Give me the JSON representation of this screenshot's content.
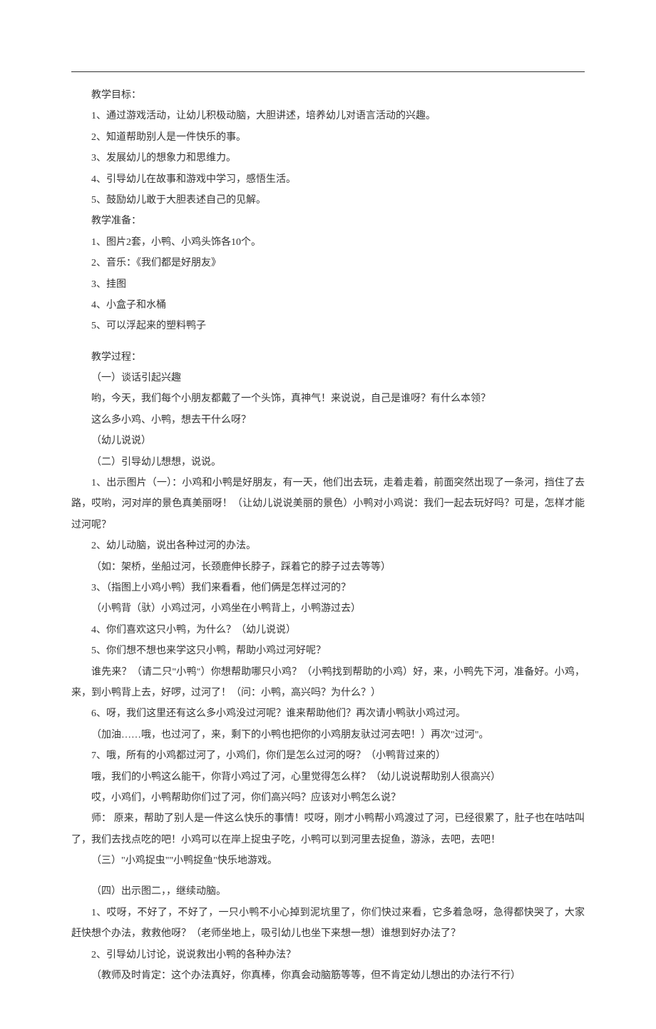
{
  "section_goals_title": "教学目标：",
  "goals": [
    "1、通过游戏活动，让幼儿积极动脑，大胆讲述，培养幼儿对语言活动的兴趣。",
    "2、知道帮助别人是一件快乐的事。",
    "3、发展幼儿的想象力和思维力。",
    "4、引导幼儿在故事和游戏中学习，感悟生活。",
    "5、鼓励幼儿敢于大胆表述自己的见解。"
  ],
  "section_prep_title": "教学准备：",
  "preps": [
    "1、图片2套，小鸭、小鸡头饰各10个。",
    "2、音乐：《我们都是好朋友》",
    "3、挂图",
    "4、小盒子和水桶",
    "5、可以浮起来的塑料鸭子"
  ],
  "section_process_title": "教学过程：",
  "part1_title": "（一）谈话引起兴趣",
  "part1_line1": "哟，今天，我们每个小朋友都戴了一个头饰，真神气！来说说，自己是谁呀？有什么本领？",
  "part1_line2": "这么多小鸡、小鸭，想去干什么呀？",
  "part1_line3": "（幼儿说说）",
  "part2_title": "（二）引导幼儿想想，说说。",
  "part2_item1": "1、出示图片（一）：小鸡和小鸭是好朋友，有一天，他们出去玩，走着走着，前面突然出现了一条河，挡住了去路，哎哟，河对岸的景色真美丽呀！（让幼儿说说美丽的景色）小鸭对小鸡说：我们一起去玩好吗？可是，怎样才能过河呢？",
  "part2_item2": "2、幼儿动脑，说出各种过河的办法。",
  "part2_item2_note": "（如：架桥，坐船过河，长颈鹿伸长脖子，踩着它的脖子过去等等）",
  "part2_item3": "3、（指图上小鸡小鸭）我们来看看，他们俩是怎样过河的？",
  "part2_item3_note": "（小鸭背（驮）小鸡过河，小鸡坐在小鸭背上，小鸭游过去）",
  "part2_item4": "4、你们喜欢这只小鸭，为什么？（幼儿说说）",
  "part2_item5": "5、你们想不想也来学这只小鸭，帮助小鸡过河好呢？",
  "part2_item5_note": "谁先来？（请二只\"小鸭\"）你想帮助哪只小鸡？（小鸭找到帮助的小鸡）好，来，小鸭先下河，准备好。小鸡，来，到小鸭背上去，好啰，过河了！（问：小鸭，高兴吗？为什么？）",
  "part2_item6": "6、呀，我们这里还有这么多小鸡没过河呢？谁来帮助他们？再次请小鸭驮小鸡过河。",
  "part2_item6_note": "（加油……哦，也过河了，来，剩下的小鸭也把你的小鸡朋友驮过河去吧！）再次\"过河\"。",
  "part2_item7": "7、哦，所有的小鸡都过河了，小鸡们，你们是怎么过河的呀？（小鸭背过来的）",
  "part2_item7_line1": "哦，我们的小鸭这么能干，你背小鸡过了河，心里觉得怎么样？（幼儿说说帮助别人很高兴）",
  "part2_item7_line2": "哎，小鸡们，小鸭帮助你们过了河，你们高兴吗？应该对小鸭怎么说？",
  "part2_item7_line3": "师： 原来，帮助了别人是一件这么快乐的事情！哎呀，刚才小鸭帮小鸡渡过了河，已经很累了，肚子也在咕咕叫了，我们去找点吃的吧！小鸡可以在岸上捉虫子吃，小鸭可以到河里去捉鱼，游泳，去吧，去吧！",
  "part3_title": "（三）\"小鸡捉虫\"\"小鸭捉鱼\"快乐地游戏。",
  "part4_title": "（四）出示图二，，继续动脑。",
  "part4_item1": "1、哎呀，不好了，不好了，一只小鸭不小心掉到泥坑里了，你们快过来看，它多着急呀，急得都快哭了，大家赶快想个办法，救救他呀？（老师坐地上，吸引幼儿也坐下来想一想）谁想到好办法了？",
  "part4_item2": "2、引导幼儿讨论，说说救出小鸭的各种办法？",
  "part4_item2_note": "（教师及时肯定：这个办法真好，你真棒，你真会动脑筋等等，但不肯定幼儿想出的办法行不行）"
}
